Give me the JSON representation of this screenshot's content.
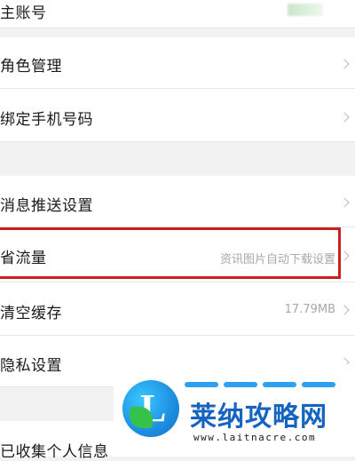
{
  "settings": {
    "main_account": {
      "label": "主账号"
    },
    "role_management": {
      "label": "角色管理"
    },
    "bind_phone": {
      "label": "绑定手机号码"
    },
    "push_settings": {
      "label": "消息推送设置"
    },
    "save_data": {
      "label": "省流量",
      "value": "资讯图片自动下载设置"
    },
    "clear_cache": {
      "label": "清空缓存",
      "value": "17.79MB"
    },
    "privacy_settings": {
      "label": "隐私设置"
    },
    "collected_info": {
      "label": "已收集个人信息"
    }
  },
  "watermark": {
    "logo_letter": "L",
    "title": "莱纳攻略网",
    "url": "www.laitnacre.com"
  },
  "colors": {
    "highlight_border": "#cc1f1f",
    "watermark_blue": "#1565c0"
  },
  "icons": {
    "chevron": "chevron-right-icon"
  }
}
